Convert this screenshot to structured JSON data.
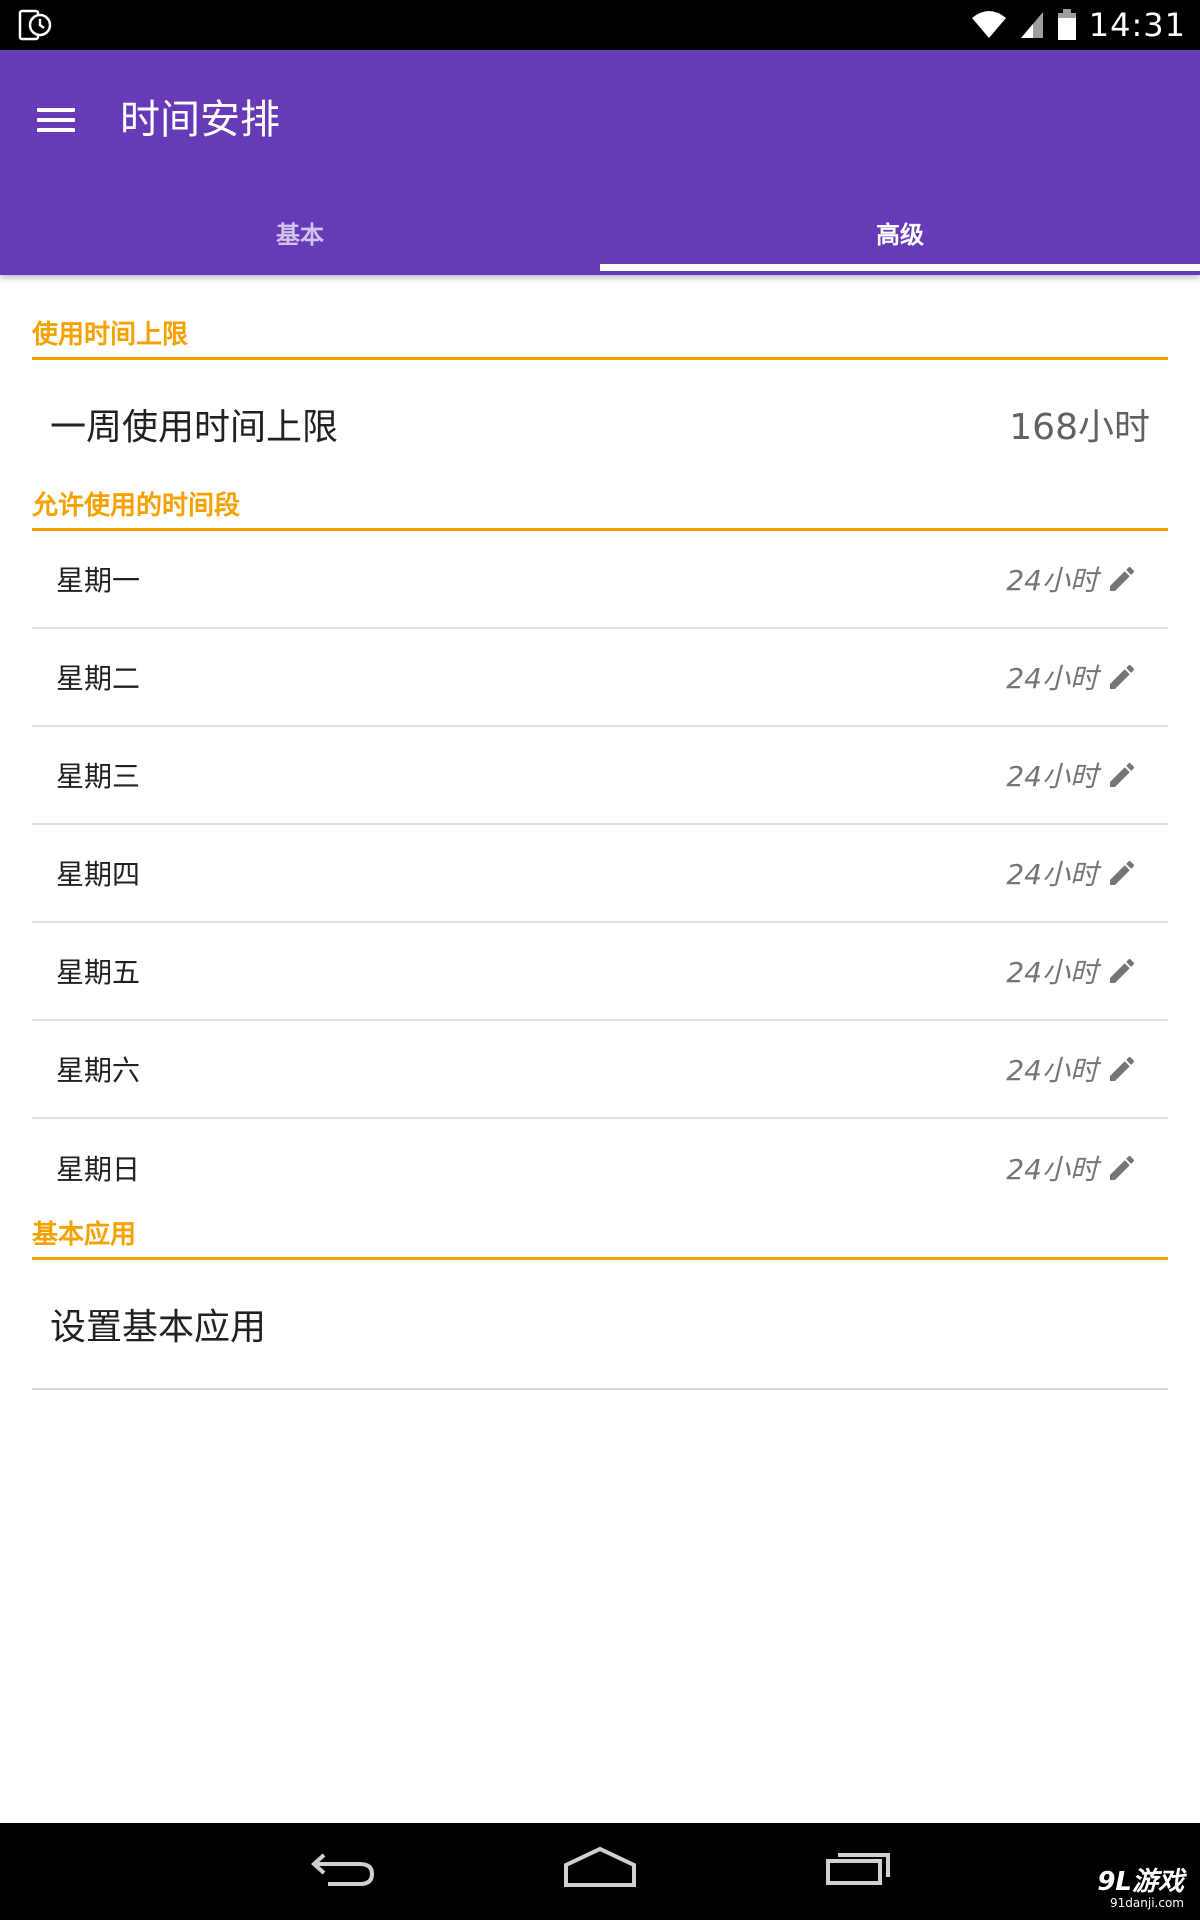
{
  "status_bar": {
    "time": "14:31",
    "icons": [
      "app-clock-icon",
      "wifi-icon",
      "signal-icon",
      "battery-icon"
    ]
  },
  "app_bar": {
    "title": "时间安排",
    "menu_icon": "menu-icon",
    "tabs": [
      {
        "label": "基本",
        "active": false
      },
      {
        "label": "高级",
        "active": true
      }
    ]
  },
  "sections": {
    "usage_limit": {
      "header": "使用时间上限",
      "weekly_label": "一周使用时间上限",
      "weekly_value": "168小时"
    },
    "allowed_periods": {
      "header": "允许使用的时间段",
      "days": [
        {
          "label": "星期一",
          "hours": "24小时"
        },
        {
          "label": "星期二",
          "hours": "24小时"
        },
        {
          "label": "星期三",
          "hours": "24小时"
        },
        {
          "label": "星期四",
          "hours": "24小时"
        },
        {
          "label": "星期五",
          "hours": "24小时"
        },
        {
          "label": "星期六",
          "hours": "24小时"
        },
        {
          "label": "星期日",
          "hours": "24小时"
        }
      ],
      "edit_icon": "pencil-icon"
    },
    "basic_apps": {
      "header": "基本应用",
      "setting_label": "设置基本应用"
    }
  },
  "nav_bar": {
    "icons": [
      "back-icon",
      "home-icon",
      "recents-icon"
    ]
  },
  "watermark": {
    "main": "9L游戏",
    "sub": "91danji.com"
  },
  "colors": {
    "primary": "#673AB7",
    "accent": "#F5A200",
    "status_bar": "#000000",
    "nav_bar": "#000000"
  }
}
